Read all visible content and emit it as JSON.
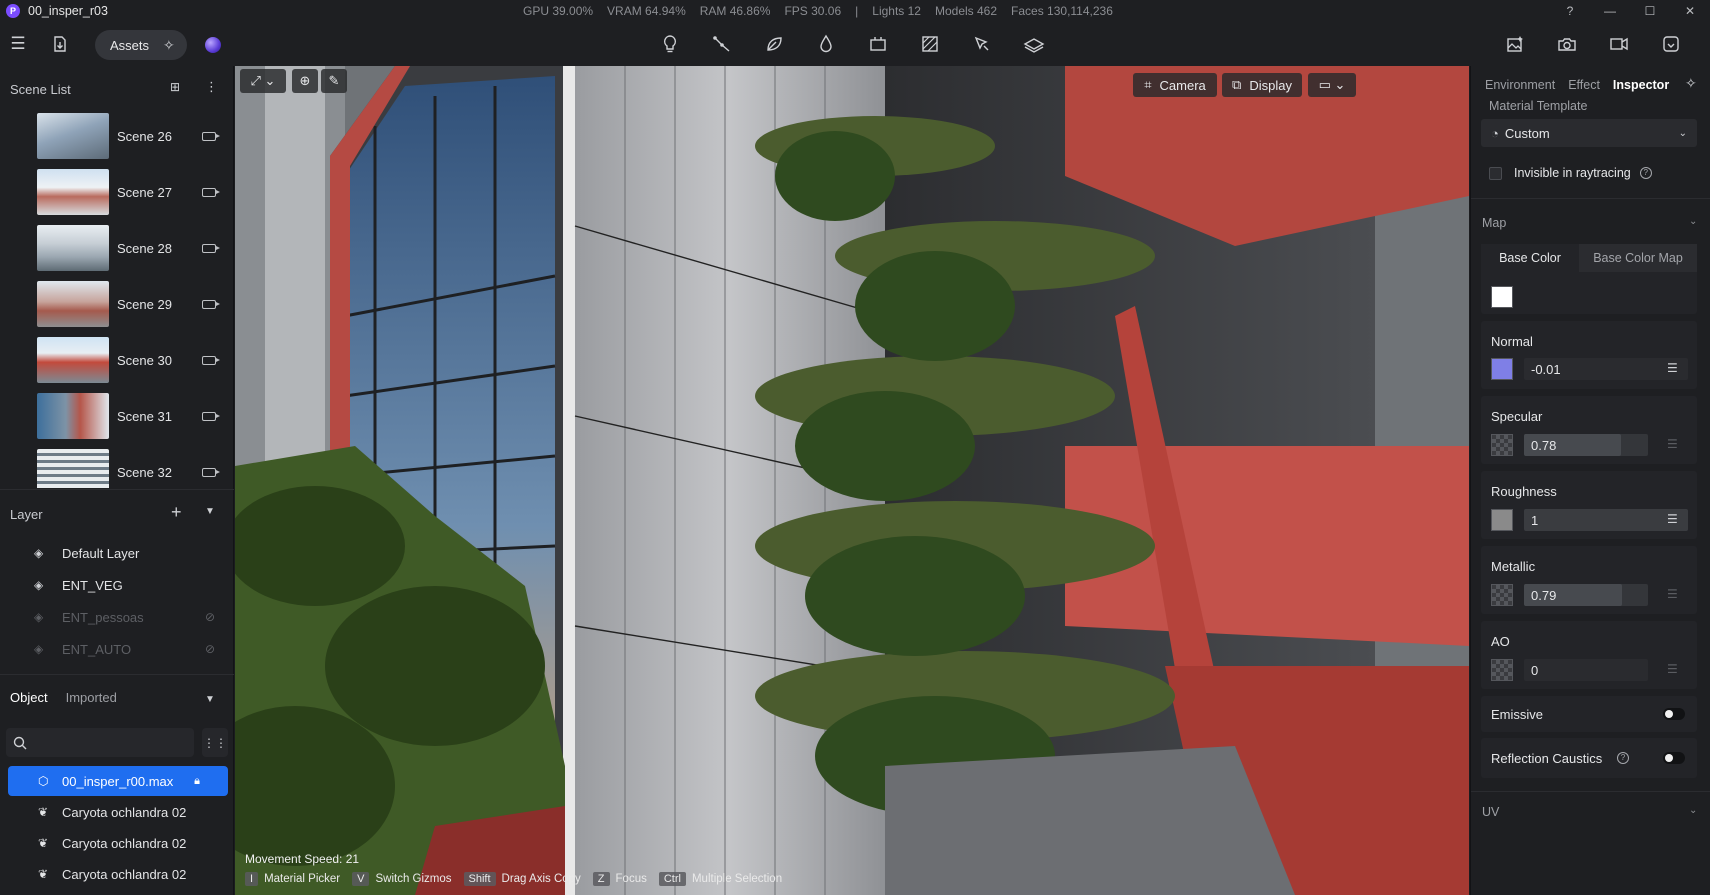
{
  "titlebar": {
    "app_logo": "P",
    "title": "00_insper_r03",
    "stats": [
      "GPU 39.00%",
      "VRAM 64.94%",
      "RAM 46.86%",
      "FPS 30.06",
      "|",
      "Lights 12",
      "Models 462",
      "Faces 130,114,236"
    ],
    "controls": [
      "?",
      "—",
      "☐",
      "✕"
    ]
  },
  "toolbar": {
    "assets_label": "Assets",
    "center_icons": [
      "light-bulb-icon",
      "path-tool-icon",
      "leaf-icon",
      "water-drop-icon",
      "animation-icon",
      "texture-icon",
      "plant-brush-icon",
      "layers-icon"
    ],
    "right_icons": [
      "render-image-icon",
      "camera-snapshot-icon",
      "video-icon",
      "export-icon"
    ]
  },
  "left_panel": {
    "scene_list_title": "Scene List",
    "scenes": [
      {
        "name": "Scene 26",
        "thumb": "#8fa3b8"
      },
      {
        "name": "Scene 27",
        "thumb": "#b96b5e"
      },
      {
        "name": "Scene 28",
        "thumb": "#9aa6b0"
      },
      {
        "name": "Scene 29",
        "thumb": "#a55a4d"
      },
      {
        "name": "Scene 30",
        "thumb": "#c24a3c"
      },
      {
        "name": "Scene 31",
        "thumb": "#7d93a6"
      },
      {
        "name": "Scene 32",
        "thumb": "#8796a4"
      }
    ],
    "layer_title": "Layer",
    "layers": [
      {
        "name": "Default Layer",
        "hidden": false
      },
      {
        "name": "ENT_VEG",
        "hidden": false
      },
      {
        "name": "ENT_pessoas",
        "hidden": true
      },
      {
        "name": "ENT_AUTO",
        "hidden": true
      }
    ],
    "object_tabs": [
      "Object",
      "Imported"
    ],
    "search_placeholder": "",
    "objects": [
      {
        "name": "00_insper_r00.max",
        "selected": true
      },
      {
        "name": "Caryota ochlandra 02",
        "selected": false
      },
      {
        "name": "Caryota ochlandra 02",
        "selected": false
      },
      {
        "name": "Caryota ochlandra 02",
        "selected": false
      }
    ]
  },
  "viewport": {
    "camera_label": "Camera",
    "display_label": "Display",
    "movement_speed": "Movement Speed: 21",
    "hints": [
      {
        "key": "I",
        "desc": "Material Picker"
      },
      {
        "key": "V",
        "desc": "Switch Gizmos"
      },
      {
        "key": "Shift",
        "desc": "Drag Axis Copy"
      },
      {
        "key": "Z",
        "desc": "Focus"
      },
      {
        "key": "Ctrl",
        "desc": "Multiple Selection"
      }
    ]
  },
  "inspector": {
    "tabs": [
      "Environment",
      "Effect",
      "Inspector"
    ],
    "material_template_label": "Material Template",
    "material_template_value": "Custom",
    "invisible_raytracing_label": "Invisible in raytracing",
    "map_label": "Map",
    "base_color_tab": "Base Color",
    "base_color_map_tab": "Base Color Map",
    "base_color": "#ffffff",
    "normal": {
      "label": "Normal",
      "value": "-0.01",
      "color": "#7f7fe6"
    },
    "specular": {
      "label": "Specular",
      "value": "0.78",
      "fraction": 0.78
    },
    "roughness": {
      "label": "Roughness",
      "value": "1",
      "color": "#8a8a8a"
    },
    "metallic": {
      "label": "Metallic",
      "value": "0.79",
      "fraction": 0.79
    },
    "ao": {
      "label": "AO",
      "value": "0"
    },
    "emissive_label": "Emissive",
    "reflection_caustics_label": "Reflection Caustics",
    "uv_label": "UV"
  }
}
